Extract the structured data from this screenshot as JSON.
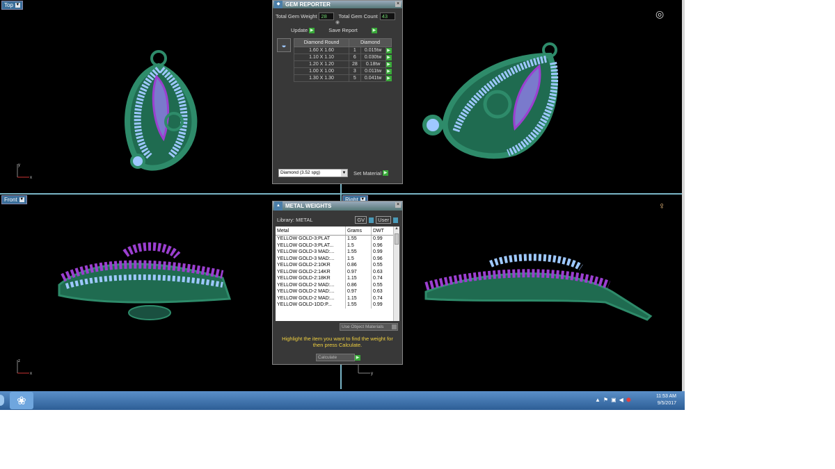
{
  "viewports": {
    "top_label": "Top",
    "front_label": "Front",
    "right_label": "Right",
    "axis_x": "x",
    "axis_y": "y",
    "axis_z": "z"
  },
  "gem_reporter": {
    "title": "GEM REPORTER",
    "total_weight_label": "Total Gem Weight",
    "total_weight_value": "28",
    "total_count_label": "Total Gem Count",
    "total_count_value": "43",
    "update_label": "Update",
    "save_report_label": "Save Report",
    "col_shape": "Diamond Round",
    "col_material": "Diamond",
    "rows": [
      {
        "size": "1.60 X 1.60",
        "count": "1",
        "weight": "0.015tw"
      },
      {
        "size": "1.10 X 1.10",
        "count": "6",
        "weight": "0.030tw"
      },
      {
        "size": "1.20 X 1.20",
        "count": "28",
        "weight": "0.18tw"
      },
      {
        "size": "1.00 X 1.00",
        "count": "3",
        "weight": "0.011tw"
      },
      {
        "size": "1.30 X 1.30",
        "count": "5",
        "weight": "0.041tw"
      }
    ],
    "material_select": "Diamond    (3.52 spg)",
    "set_material_label": "Set Material"
  },
  "metal_weights": {
    "title": "METAL WEIGHTS",
    "library_label": "Library: METAL",
    "gv_label": "GV",
    "user_label": "User",
    "col_metal": "Metal",
    "col_grams": "Grams",
    "col_dwt": "DWT",
    "rows": [
      {
        "metal": "YELLOW GOLD-3:PLAT",
        "grams": "1.55",
        "dwt": "0.99"
      },
      {
        "metal": "YELLOW GOLD-3:PLAT...",
        "grams": "1.5",
        "dwt": "0.96"
      },
      {
        "metal": "YELLOW GOLD-3 MAD:...",
        "grams": "1.55",
        "dwt": "0.99"
      },
      {
        "metal": "YELLOW GOLD-3 MAD:...",
        "grams": "1.5",
        "dwt": "0.96"
      },
      {
        "metal": "YELLOW GOLD-2:10KR",
        "grams": "0.86",
        "dwt": "0.55"
      },
      {
        "metal": "YELLOW GOLD-2:14KR",
        "grams": "0.97",
        "dwt": "0.63"
      },
      {
        "metal": "YELLOW GOLD-2:18KR",
        "grams": "1.15",
        "dwt": "0.74"
      },
      {
        "metal": "YELLOW GOLD-2 MAD:...",
        "grams": "0.86",
        "dwt": "0.55"
      },
      {
        "metal": "YELLOW GOLD-2 MAD:...",
        "grams": "0.97",
        "dwt": "0.63"
      },
      {
        "metal": "YELLOW GOLD-2 MAD:...",
        "grams": "1.15",
        "dwt": "0.74"
      },
      {
        "metal": "YELLOW GOLD-1DD:P...",
        "grams": "1.55",
        "dwt": "0.99"
      }
    ],
    "use_object_materials": "Use Object Materials",
    "hint": "Highlight the item you want to find the weight for then press Calculate.",
    "calculate_label": "Calculate"
  },
  "taskbar": {
    "time": "11:53 AM",
    "date": "9/5/2017"
  },
  "colors": {
    "metal_green": "#2e8b6a",
    "gem_light": "#9ec8ff",
    "gem_purple": "#9b3fd0",
    "hint_yellow": "#f0d040"
  }
}
